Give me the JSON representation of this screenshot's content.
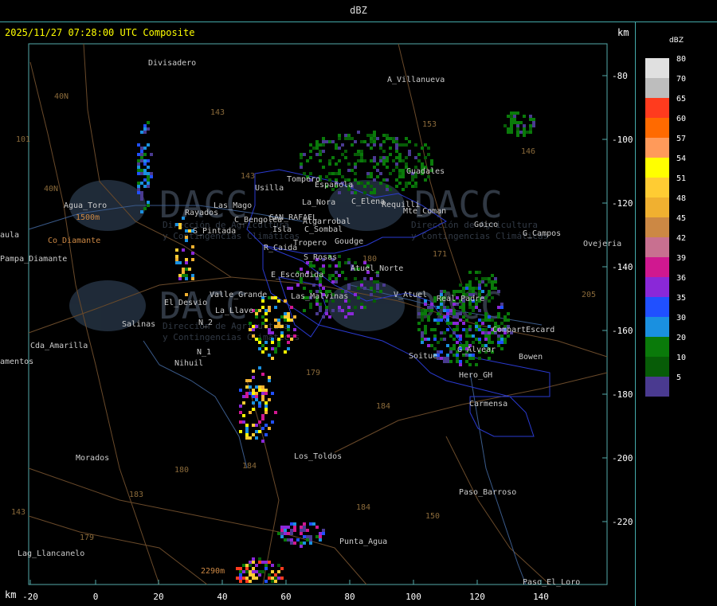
{
  "header": {
    "title": "dBZ"
  },
  "map": {
    "title": "2025/11/27 07:28:00 UTC Composite",
    "km_label_top": "km",
    "km_label_bottom": "km",
    "x_ticks": [
      "-20",
      "0",
      "20",
      "40",
      "60",
      "80",
      "100",
      "120",
      "140"
    ],
    "y_ticks": [
      "-80",
      "-100",
      "-120",
      "-140",
      "-160",
      "-180",
      "-200",
      "-220"
    ],
    "watermark": "DACC",
    "watermark_sub1": "Dirección de Agricultura",
    "watermark_sub2": "y Contingencias Climáticas",
    "places": [
      {
        "name": "Divisadero",
        "color": "#cccccc"
      },
      {
        "name": "A_Villanueva",
        "color": "#cccccc"
      },
      {
        "name": "Guadales",
        "color": "#cccccc"
      },
      {
        "name": "Agua_Toro",
        "color": "#cccccc"
      },
      {
        "name": "1500m",
        "color": "#cc8844"
      },
      {
        "name": "Rayados",
        "color": "#cccccc"
      },
      {
        "name": "Las_Malvinas",
        "color": "#cccccc"
      },
      {
        "name": "Goico",
        "color": "#cccccc"
      },
      {
        "name": "G_Campos",
        "color": "#cccccc"
      },
      {
        "name": "Ovejeria",
        "color": "#cccccc"
      },
      {
        "name": "Pampa_Diamante",
        "color": "#cccccc"
      },
      {
        "name": "aula",
        "color": "#cccccc"
      },
      {
        "name": "S_Pintada",
        "color": "#cccccc"
      },
      {
        "name": "El_Desvio",
        "color": "#cccccc"
      },
      {
        "name": "Valle_Grande",
        "color": "#cccccc"
      },
      {
        "name": "Salinas",
        "color": "#cccccc"
      },
      {
        "name": "Cda_Amarilla",
        "color": "#cccccc"
      },
      {
        "name": "amentos",
        "color": "#cccccc"
      },
      {
        "name": "N_2",
        "color": "#cccccc"
      },
      {
        "name": "N_1",
        "color": "#cccccc"
      },
      {
        "name": "Nihuil",
        "color": "#cccccc"
      },
      {
        "name": "La_Llave",
        "color": "#cccccc"
      },
      {
        "name": "Los_Toldos",
        "color": "#cccccc"
      },
      {
        "name": "Morados",
        "color": "#cccccc"
      },
      {
        "name": "Paso_Barroso",
        "color": "#cccccc"
      },
      {
        "name": "Punta_Agua",
        "color": "#cccccc"
      },
      {
        "name": "Lag_Llancanelo",
        "color": "#cccccc"
      },
      {
        "name": "Paso_El_Loro",
        "color": "#cccccc"
      },
      {
        "name": "Carmensa",
        "color": "#cccccc"
      },
      {
        "name": "Soitue",
        "color": "#cccccc"
      },
      {
        "name": "Bowen",
        "color": "#cccccc"
      },
      {
        "name": "CompartEscard",
        "color": "#cccccc"
      },
      {
        "name": "Hero_GH",
        "color": "#cccccc"
      },
      {
        "name": "G_Alvear",
        "color": "#cccccc"
      },
      {
        "name": "V_Atuel",
        "color": "#cccccc"
      },
      {
        "name": "Real_Padre",
        "color": "#cccccc"
      },
      {
        "name": "Atuel_Norte",
        "color": "#cccccc"
      },
      {
        "name": "S_Rosas",
        "color": "#cccccc"
      },
      {
        "name": "R_Caida",
        "color": "#cccccc"
      },
      {
        "name": "E_Escondida",
        "color": "#cccccc"
      },
      {
        "name": "C_Bengolea",
        "color": "#cccccc"
      },
      {
        "name": "SAN_RAFAEL",
        "color": "#cccccc"
      },
      {
        "name": "Algarrobal",
        "color": "#cccccc"
      },
      {
        "name": "C_Sombal",
        "color": "#cccccc"
      },
      {
        "name": "Isla",
        "color": "#cccccc"
      },
      {
        "name": "Tropero",
        "color": "#cccccc"
      },
      {
        "name": "Goudge",
        "color": "#cccccc"
      },
      {
        "name": "Usilla",
        "color": "#cccccc"
      },
      {
        "name": "Tompero",
        "color": "#cccccc"
      },
      {
        "name": "Española",
        "color": "#cccccc"
      },
      {
        "name": "La_Nora",
        "color": "#cccccc"
      },
      {
        "name": "C_Elena",
        "color": "#cccccc"
      },
      {
        "name": "Requilli",
        "color": "#cccccc"
      },
      {
        "name": "Mte_Coman",
        "color": "#cccccc"
      },
      {
        "name": "Las_Mago",
        "color": "#cccccc"
      },
      {
        "name": "Co_Diamante",
        "color": "#cc8844"
      },
      {
        "name": "2290m",
        "color": "#cc8844"
      }
    ],
    "route_labels": [
      "40N",
      "101",
      "40N",
      "143",
      "143",
      "153",
      "146",
      "171",
      "179",
      "184",
      "180",
      "184",
      "183",
      "179",
      "184",
      "143",
      "180",
      "150",
      "205"
    ]
  },
  "legend": {
    "title": "dBZ",
    "items": [
      {
        "value": "80",
        "color": "#e0e0e0"
      },
      {
        "value": "70",
        "color": "#bdbdbd"
      },
      {
        "value": "65",
        "color": "#ff3b1e"
      },
      {
        "value": "60",
        "color": "#ff6a00"
      },
      {
        "value": "57",
        "color": "#ff9a5a"
      },
      {
        "value": "54",
        "color": "#ffff00"
      },
      {
        "value": "51",
        "color": "#ffcc33"
      },
      {
        "value": "48",
        "color": "#f0b030"
      },
      {
        "value": "45",
        "color": "#cc8844"
      },
      {
        "value": "42",
        "color": "#c87090"
      },
      {
        "value": "39",
        "color": "#d01890"
      },
      {
        "value": "36",
        "color": "#8a28d8"
      },
      {
        "value": "35",
        "color": "#2050ff"
      },
      {
        "value": "30",
        "color": "#1a90e0"
      },
      {
        "value": "20",
        "color": "#0a7a0a"
      },
      {
        "value": "10",
        "color": "#075c07"
      },
      {
        "value": "5",
        "color": "#4a3a90"
      }
    ]
  }
}
